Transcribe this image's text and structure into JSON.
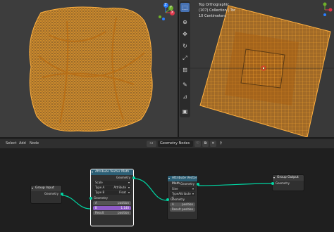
{
  "viewport_right": {
    "view_name": "Top Orthographic",
    "collection_line": "(107) Collection | Tor",
    "scale_line": "10 Centimeters"
  },
  "gizmo": {
    "x_label": "X",
    "y_label": "Y",
    "z_label": "Z"
  },
  "toolbar_icons": [
    "select-box-icon",
    "cursor-icon",
    "move-icon",
    "rotate-icon",
    "scale-icon",
    "transform-icon",
    "annotate-icon",
    "measure-icon",
    "add-cube-icon"
  ],
  "node_editor_header": {
    "menus": [
      "Select",
      "Add",
      "Node"
    ],
    "tree_name": "Geometry Nodes"
  },
  "nodes": {
    "group_input": {
      "title": "Group Input",
      "out_geometry": "Geometry"
    },
    "attr_vec_math_1": {
      "title": "Attribute Vector Math",
      "out_geometry": "Geometry",
      "operation": "Scale",
      "type_a_label": "Type A",
      "type_a_value": "Attribute",
      "type_b_label": "Type B",
      "type_b_value": "Float",
      "in_geometry": "Geometry",
      "a_label": "A",
      "a_value": "position",
      "b_label": "B",
      "b_value": "1.140",
      "result_label": "Result",
      "result_value": "position"
    },
    "attr_vec_math_2": {
      "title": "Attribute Vector Math",
      "out_geometry": "Geometry",
      "operation": "Sine",
      "type_a_label": "Type A",
      "type_a_value": "Attribute",
      "in_geometry": "Geometry",
      "a_label": "A",
      "a_value": "position",
      "result_label": "Result",
      "result_value": "position"
    },
    "group_output": {
      "title": "Group Output",
      "in_geometry": "Geometry"
    }
  },
  "colors": {
    "wireframe": "#f5a020",
    "selected_node_border": "#ffffff",
    "geometry_socket": "#00d6a3",
    "active_tool": "#4772b3"
  }
}
